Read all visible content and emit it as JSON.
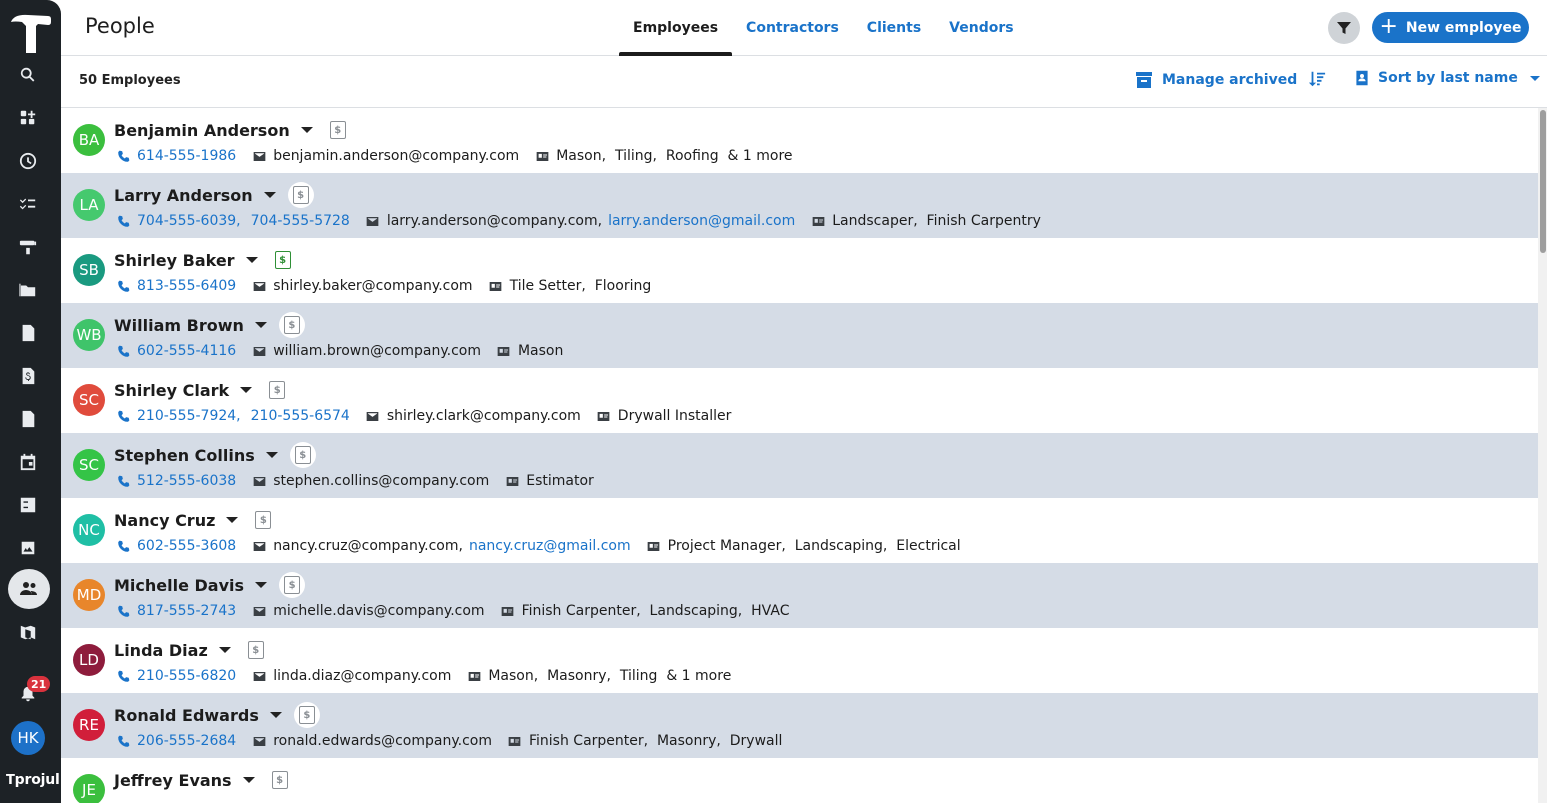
{
  "sidebar": {
    "brand": "projul",
    "notification_count": "21",
    "user_initials": "HK"
  },
  "header": {
    "title": "People",
    "tabs": [
      {
        "label": "Employees",
        "active": true
      },
      {
        "label": "Contractors",
        "active": false
      },
      {
        "label": "Clients",
        "active": false
      },
      {
        "label": "Vendors",
        "active": false
      }
    ],
    "new_button": "New employee"
  },
  "toolbar": {
    "count_label": "50 Employees",
    "manage_archived": "Manage archived",
    "sort_label": "Sort by last name"
  },
  "people": [
    {
      "initials": "BA",
      "name": "Benjamin Anderson",
      "color": "#3bbf3e",
      "pay_style": "plain",
      "phones": [
        "614-555-1986"
      ],
      "emails": [
        "benjamin.anderson@company.com"
      ],
      "trades": "Mason,  Tiling,  Roofing  & 1 more"
    },
    {
      "initials": "LA",
      "name": "Larry Anderson",
      "color": "#45c96e",
      "pay_style": "circ",
      "phones": [
        "704-555-6039,",
        "704-555-5728"
      ],
      "emails": [
        "larry.anderson@company.com,"
      ],
      "email_link": "larry.anderson@gmail.com",
      "trades": "Landscaper,  Finish Carpentry"
    },
    {
      "initials": "SB",
      "name": "Shirley Baker",
      "color": "#1a9a80",
      "pay_style": "green",
      "phones": [
        "813-555-6409"
      ],
      "emails": [
        "shirley.baker@company.com"
      ],
      "trades": "Tile Setter,  Flooring"
    },
    {
      "initials": "WB",
      "name": "William Brown",
      "color": "#3fc46a",
      "pay_style": "circ",
      "phones": [
        "602-555-4116"
      ],
      "emails": [
        "william.brown@company.com"
      ],
      "trades": "Mason"
    },
    {
      "initials": "SC",
      "name": "Shirley Clark",
      "color": "#e04b3c",
      "pay_style": "plain",
      "phones": [
        "210-555-7924,",
        "210-555-6574"
      ],
      "emails": [
        "shirley.clark@company.com"
      ],
      "trades": "Drywall Installer"
    },
    {
      "initials": "SC",
      "name": "Stephen Collins",
      "color": "#34c447",
      "pay_style": "circ",
      "phones": [
        "512-555-6038"
      ],
      "emails": [
        "stephen.collins@company.com"
      ],
      "trades": "Estimator"
    },
    {
      "initials": "NC",
      "name": "Nancy Cruz",
      "color": "#1fbfa5",
      "pay_style": "plain",
      "phones": [
        "602-555-3608"
      ],
      "emails": [
        "nancy.cruz@company.com,"
      ],
      "email_link": "nancy.cruz@gmail.com",
      "trades": "Project Manager,  Landscaping,  Electrical"
    },
    {
      "initials": "MD",
      "name": "Michelle Davis",
      "color": "#e8862b",
      "pay_style": "circ",
      "phones": [
        "817-555-2743"
      ],
      "emails": [
        "michelle.davis@company.com"
      ],
      "trades": "Finish Carpenter,  Landscaping,  HVAC"
    },
    {
      "initials": "LD",
      "name": "Linda Diaz",
      "color": "#8e1c3c",
      "pay_style": "plain",
      "phones": [
        "210-555-6820"
      ],
      "emails": [
        "linda.diaz@company.com"
      ],
      "trades": "Mason,  Masonry,  Tiling  & 1 more"
    },
    {
      "initials": "RE",
      "name": "Ronald Edwards",
      "color": "#d11e3a",
      "pay_style": "circ",
      "phones": [
        "206-555-2684"
      ],
      "emails": [
        "ronald.edwards@company.com"
      ],
      "trades": "Finish Carpenter,  Masonry,  Drywall"
    },
    {
      "initials": "JE",
      "name": "Jeffrey Evans",
      "color": "#3bbf3e",
      "pay_style": "plain",
      "phones": [],
      "emails": [],
      "trades": ""
    }
  ]
}
